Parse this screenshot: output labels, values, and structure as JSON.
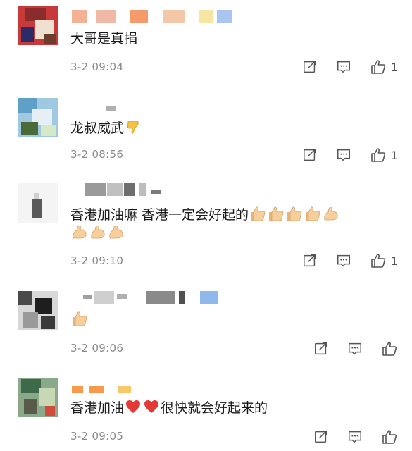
{
  "colors": {
    "text": "#1a1a1a",
    "meta": "#8a8a8a",
    "icon": "#555555",
    "heart": "#e53935"
  },
  "comments": [
    {
      "text": "大哥是真捐",
      "time": "3-2 09:04",
      "likes": "1"
    },
    {
      "text": "龙叔威武",
      "time": "3-2 08:56",
      "likes": "1"
    },
    {
      "text_line1": "香港加油嘛  香港一定会好起的",
      "time": "3-2 09:10",
      "likes": "1"
    },
    {
      "time": "3-2 09:06",
      "likes": ""
    },
    {
      "text_a": "香港加油",
      "text_b": "很快就会好起来的",
      "time": "3-2 09:05",
      "likes": ""
    }
  ]
}
